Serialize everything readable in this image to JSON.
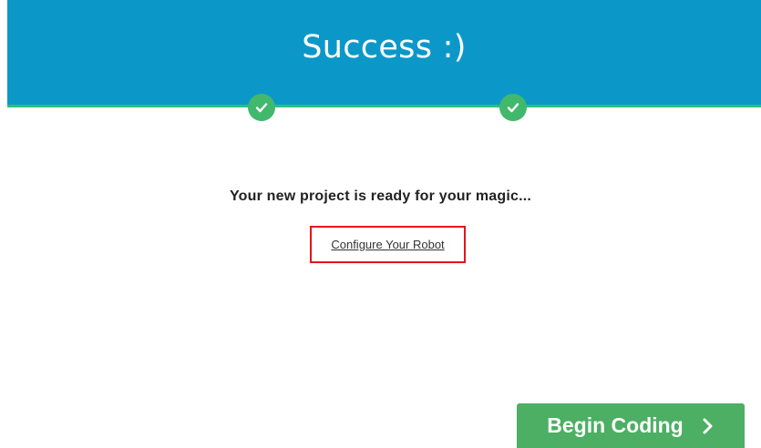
{
  "header": {
    "title": "Success :)"
  },
  "steps": [
    {
      "status": "complete",
      "icon": "checkmark-icon"
    },
    {
      "status": "complete",
      "icon": "checkmark-icon"
    }
  ],
  "main": {
    "message": "Your new project is ready for your magic...",
    "configure_link": "Configure Your Robot"
  },
  "footer": {
    "begin_button_label": "Begin Coding",
    "begin_button_icon": "chevron-right-icon"
  },
  "colors": {
    "header_bg": "#0b98c9",
    "header_underline": "#27c47c",
    "check_bg": "#42b86c",
    "button_bg": "#4caf63",
    "highlight_border": "#e8121b"
  }
}
